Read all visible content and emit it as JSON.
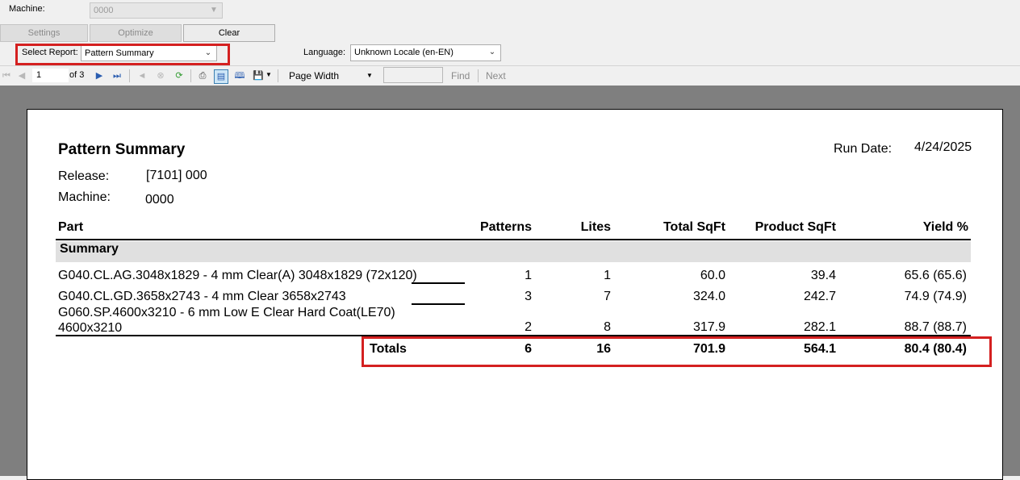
{
  "toolbar_top": {
    "machine_label": "Machine:",
    "machine_value": "0000",
    "settings_label": "Settings",
    "optimize_label": "Optimize",
    "clear_label": "Clear",
    "select_report_label": "Select Report:",
    "select_report_value": "Pattern Summary",
    "language_label": "Language:",
    "language_value": "Unknown Locale (en-EN)"
  },
  "report_toolbar": {
    "page_current": "1",
    "page_of": "of 3",
    "zoom_value": "Page Width",
    "find_input": "",
    "find_label": "Find",
    "next_label": "Next",
    "icons": [
      "first-page-icon",
      "prev-page-icon",
      "next-page-icon",
      "last-page-icon",
      "back-icon",
      "stop-icon",
      "refresh-icon",
      "print-icon",
      "print-layout-icon",
      "page-setup-icon",
      "export-icon"
    ]
  },
  "report": {
    "title": "Pattern Summary",
    "run_date_label": "Run Date:",
    "run_date_value": "4/24/2025",
    "release_label": "Release:",
    "release_value": "[7101] 000",
    "machine_label": "Machine:",
    "machine_value": "0000",
    "columns": [
      "Part",
      "Patterns",
      "Lites",
      "Total SqFt",
      "Product SqFt",
      "Yield %"
    ],
    "section_label": "Summary",
    "rows": [
      {
        "part": "G040.CL.AG.3048x1829 - 4 mm Clear(A) 3048x1829 (72x120)",
        "patterns": "1",
        "lites": "1",
        "total": "60.0",
        "product": "39.4",
        "yield": "65.6 (65.6)"
      },
      {
        "part": "G040.CL.GD.3658x2743 - 4 mm Clear 3658x2743",
        "patterns": "3",
        "lites": "7",
        "total": "324.0",
        "product": "242.7",
        "yield": "74.9 (74.9)"
      },
      {
        "part_line1": "G060.SP.4600x3210 - 6 mm Low E Clear Hard Coat(LE70)",
        "part_line2": "4600x3210",
        "patterns": "2",
        "lites": "8",
        "total": "317.9",
        "product": "282.1",
        "yield": "88.7 (88.7)"
      }
    ],
    "totals": {
      "label": "Totals",
      "patterns": "6",
      "lites": "16",
      "total": "701.9",
      "product": "564.1",
      "yield": "80.4 (80.4)"
    }
  },
  "colors": {
    "highlight": "#d42020",
    "viewer_bg": "#7f7f7f",
    "section_bg": "#e0e0e0"
  }
}
